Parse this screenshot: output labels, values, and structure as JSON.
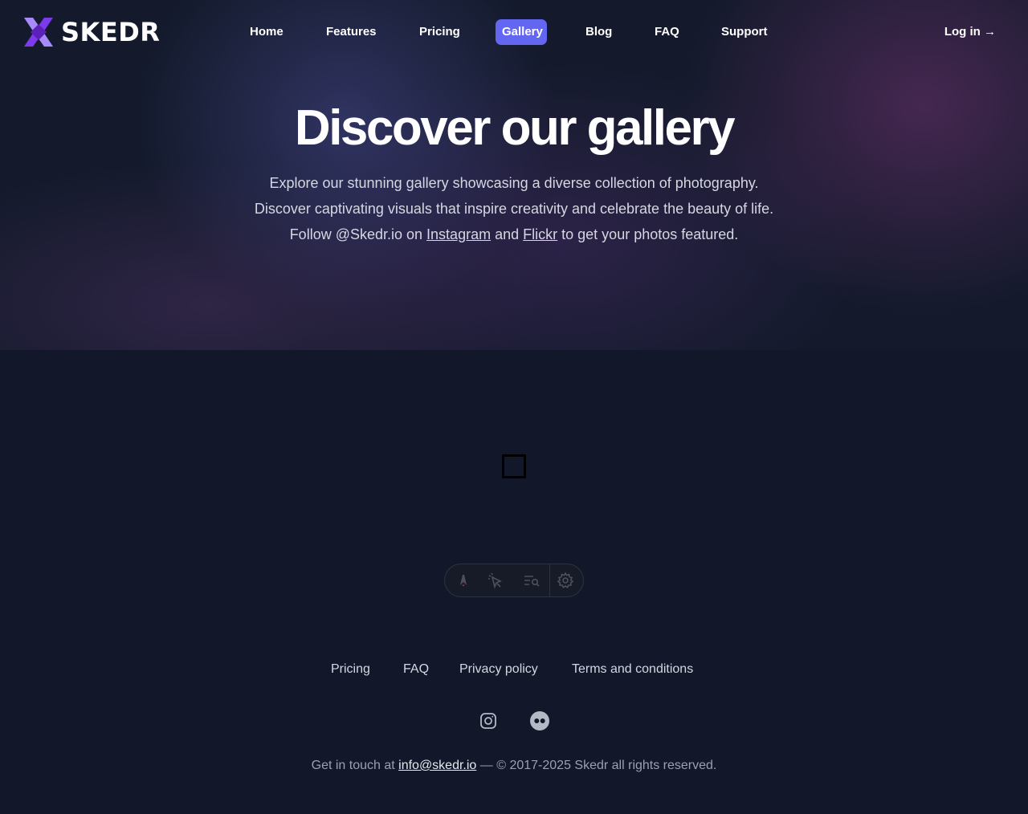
{
  "brand": {
    "name": "SKEDR",
    "logo_colors": [
      "#8b5cf6",
      "#6d28d9",
      "#a78bfa"
    ]
  },
  "nav": {
    "items": [
      {
        "label": "Home"
      },
      {
        "label": "Features"
      },
      {
        "label": "Pricing"
      },
      {
        "label": "Gallery",
        "active": true
      },
      {
        "label": "Blog"
      },
      {
        "label": "FAQ"
      },
      {
        "label": "Support"
      }
    ],
    "login_label": "Log in →",
    "active_color": "#6366f1"
  },
  "hero": {
    "title": "Discover our gallery",
    "line1": "Explore our stunning gallery showcasing a diverse collection of photography.",
    "line2": "Discover captivating visuals that inspire creativity and celebrate the beauty of life.",
    "line3_prefix": "Follow @Skedr.io on ",
    "line3_link1": "Instagram",
    "line3_mid": " and ",
    "line3_link2": "Flickr",
    "line3_suffix": " to get your photos featured."
  },
  "toolbar": {
    "icons": [
      "astro-icon",
      "cursor-inspect-icon",
      "search-list-icon",
      "settings-gear-icon"
    ]
  },
  "footer": {
    "links": [
      {
        "label": "Pricing"
      },
      {
        "label": "FAQ"
      },
      {
        "label": "Privacy policy"
      },
      {
        "label": "Terms and conditions"
      }
    ],
    "social": [
      "instagram-icon",
      "flickr-icon"
    ],
    "contact_prefix": "Get in touch at ",
    "contact_email": "info@skedr.io",
    "contact_suffix": " — © 2017-2025 Skedr all rights reserved."
  },
  "colors": {
    "background": "#121829",
    "text_muted": "#9aa0b0",
    "text": "#d5d7e2"
  }
}
